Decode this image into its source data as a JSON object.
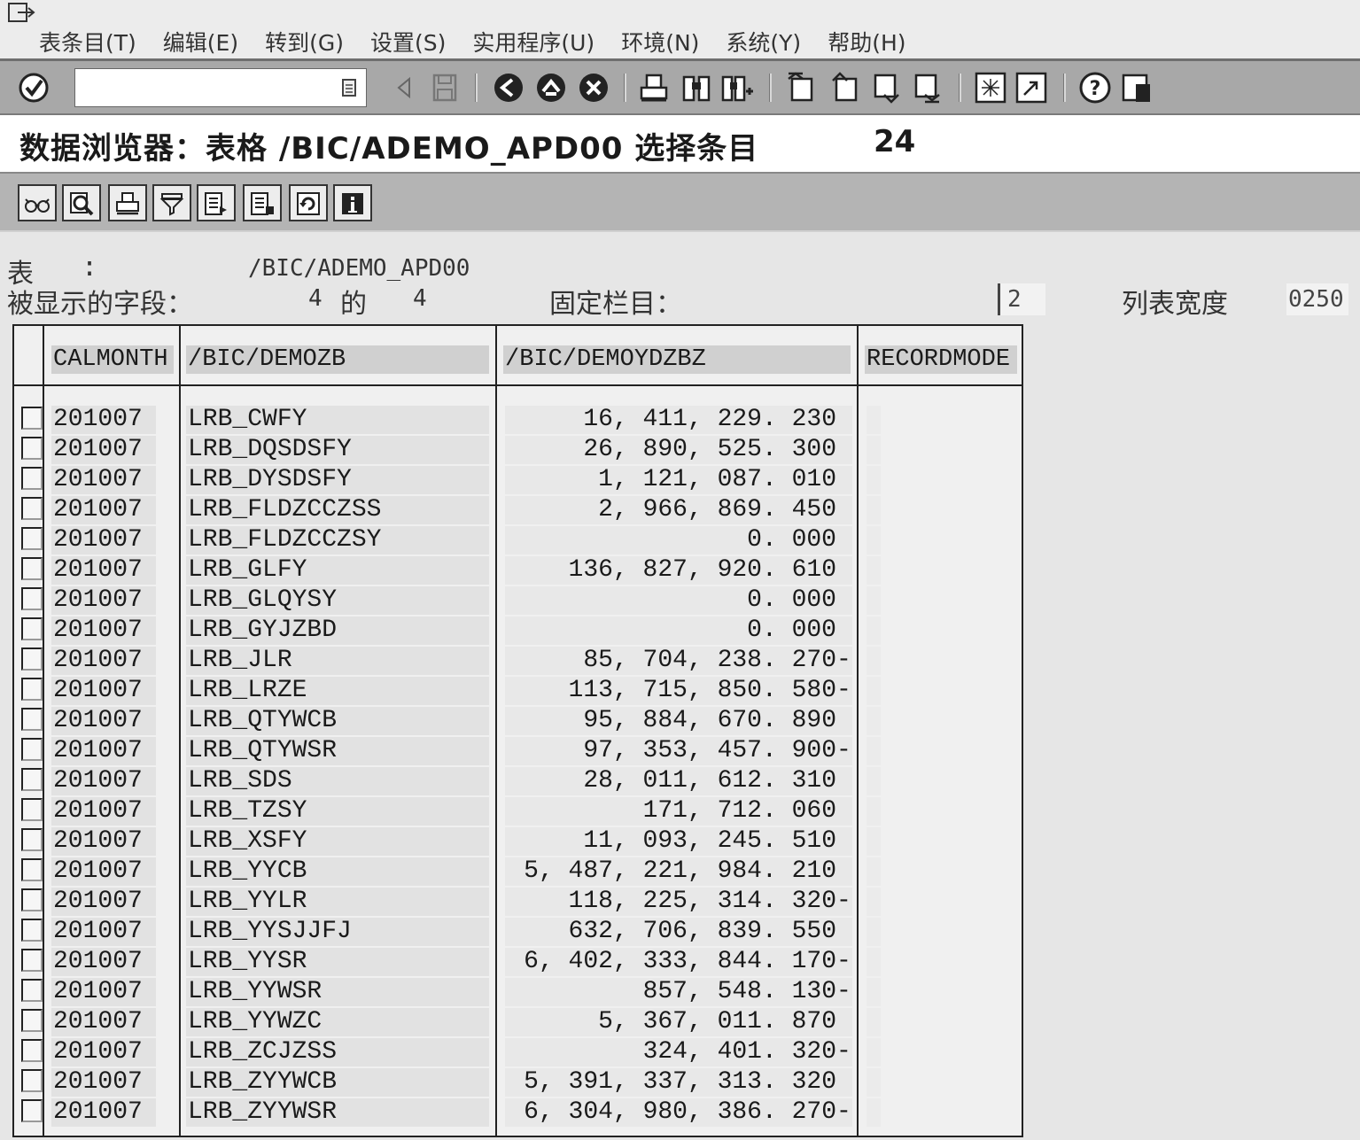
{
  "menu": {
    "items": [
      "表条目(T)",
      "编辑(E)",
      "转到(G)",
      "设置(S)",
      "实用程序(U)",
      "环境(N)",
      "系统(Y)",
      "帮助(H)"
    ]
  },
  "toolbar": {
    "command_value": "",
    "icons": [
      "enter-icon",
      "back-icon",
      "save-icon",
      "back-nav-icon",
      "exit-icon",
      "cancel-icon",
      "print-icon",
      "find-icon",
      "find-next-icon",
      "first-page-icon",
      "previous-page-icon",
      "next-page-icon",
      "last-page-icon",
      "new-session-icon",
      "shortcut-icon",
      "help-icon",
      "layout-icon"
    ]
  },
  "title": {
    "text": "数据浏览器：表格 /BIC/ADEMO_APD00 选择条目",
    "count": "24"
  },
  "app_toolbar": {
    "icons": [
      "glasses-icon",
      "detail-icon",
      "print-icon",
      "filter-icon",
      "export-icon",
      "export-local-icon",
      "refresh-icon",
      "info-icon"
    ]
  },
  "info": {
    "table_label": "表",
    "table_colon": ":",
    "table_value": "/BIC/ADEMO_APD00",
    "fields_label": "被显示的字段：",
    "fields_shown": "4",
    "fields_of": "的",
    "fields_total": "4",
    "fixed_label": "固定栏目：",
    "fixed_value": "2",
    "width_label": "列表宽度",
    "width_value": "0250"
  },
  "table": {
    "columns": [
      "CALMONTH",
      "/BIC/DEMOZB",
      "/BIC/DEMOYDZBZ",
      "RECORDMODE"
    ],
    "rows": [
      {
        "calmonth": "201007",
        "zb": "LRB_CWFY",
        "value": "16, 411, 229. 230",
        "sign": "",
        "recordmode": ""
      },
      {
        "calmonth": "201007",
        "zb": "LRB_DQSDSFY",
        "value": "26, 890, 525. 300",
        "sign": "",
        "recordmode": ""
      },
      {
        "calmonth": "201007",
        "zb": "LRB_DYSDSFY",
        "value": "1, 121, 087. 010",
        "sign": "",
        "recordmode": ""
      },
      {
        "calmonth": "201007",
        "zb": "LRB_FLDZCCZSS",
        "value": "2, 966, 869. 450",
        "sign": "",
        "recordmode": ""
      },
      {
        "calmonth": "201007",
        "zb": "LRB_FLDZCCZSY",
        "value": "0. 000",
        "sign": "",
        "recordmode": ""
      },
      {
        "calmonth": "201007",
        "zb": "LRB_GLFY",
        "value": "136, 827, 920. 610",
        "sign": "",
        "recordmode": ""
      },
      {
        "calmonth": "201007",
        "zb": "LRB_GLQYSY",
        "value": "0. 000",
        "sign": "",
        "recordmode": ""
      },
      {
        "calmonth": "201007",
        "zb": "LRB_GYJZBD",
        "value": "0. 000",
        "sign": "",
        "recordmode": ""
      },
      {
        "calmonth": "201007",
        "zb": "LRB_JLR",
        "value": "85, 704, 238. 270",
        "sign": "-",
        "recordmode": ""
      },
      {
        "calmonth": "201007",
        "zb": "LRB_LRZE",
        "value": "113, 715, 850. 580",
        "sign": "-",
        "recordmode": ""
      },
      {
        "calmonth": "201007",
        "zb": "LRB_QTYWCB",
        "value": "95, 884, 670. 890",
        "sign": "",
        "recordmode": ""
      },
      {
        "calmonth": "201007",
        "zb": "LRB_QTYWSR",
        "value": "97, 353, 457. 900",
        "sign": "-",
        "recordmode": ""
      },
      {
        "calmonth": "201007",
        "zb": "LRB_SDS",
        "value": "28, 011, 612. 310",
        "sign": "",
        "recordmode": ""
      },
      {
        "calmonth": "201007",
        "zb": "LRB_TZSY",
        "value": "171, 712. 060",
        "sign": "",
        "recordmode": ""
      },
      {
        "calmonth": "201007",
        "zb": "LRB_XSFY",
        "value": "11, 093, 245. 510",
        "sign": "",
        "recordmode": ""
      },
      {
        "calmonth": "201007",
        "zb": "LRB_YYCB",
        "value": "5, 487, 221, 984. 210",
        "sign": "",
        "recordmode": ""
      },
      {
        "calmonth": "201007",
        "zb": "LRB_YYLR",
        "value": "118, 225, 314. 320",
        "sign": "-",
        "recordmode": ""
      },
      {
        "calmonth": "201007",
        "zb": "LRB_YYSJJFJ",
        "value": "632, 706, 839. 550",
        "sign": "",
        "recordmode": ""
      },
      {
        "calmonth": "201007",
        "zb": "LRB_YYSR",
        "value": "6, 402, 333, 844. 170",
        "sign": "-",
        "recordmode": ""
      },
      {
        "calmonth": "201007",
        "zb": "LRB_YYWSR",
        "value": "857, 548. 130",
        "sign": "-",
        "recordmode": ""
      },
      {
        "calmonth": "201007",
        "zb": "LRB_YYWZC",
        "value": "5, 367, 011. 870",
        "sign": "",
        "recordmode": ""
      },
      {
        "calmonth": "201007",
        "zb": "LRB_ZCJZSS",
        "value": "324, 401. 320",
        "sign": "-",
        "recordmode": ""
      },
      {
        "calmonth": "201007",
        "zb": "LRB_ZYYWCB",
        "value": "5, 391, 337, 313. 320",
        "sign": "",
        "recordmode": ""
      },
      {
        "calmonth": "201007",
        "zb": "LRB_ZYYWSR",
        "value": "6, 304, 980, 386. 270",
        "sign": "-",
        "recordmode": ""
      }
    ]
  }
}
